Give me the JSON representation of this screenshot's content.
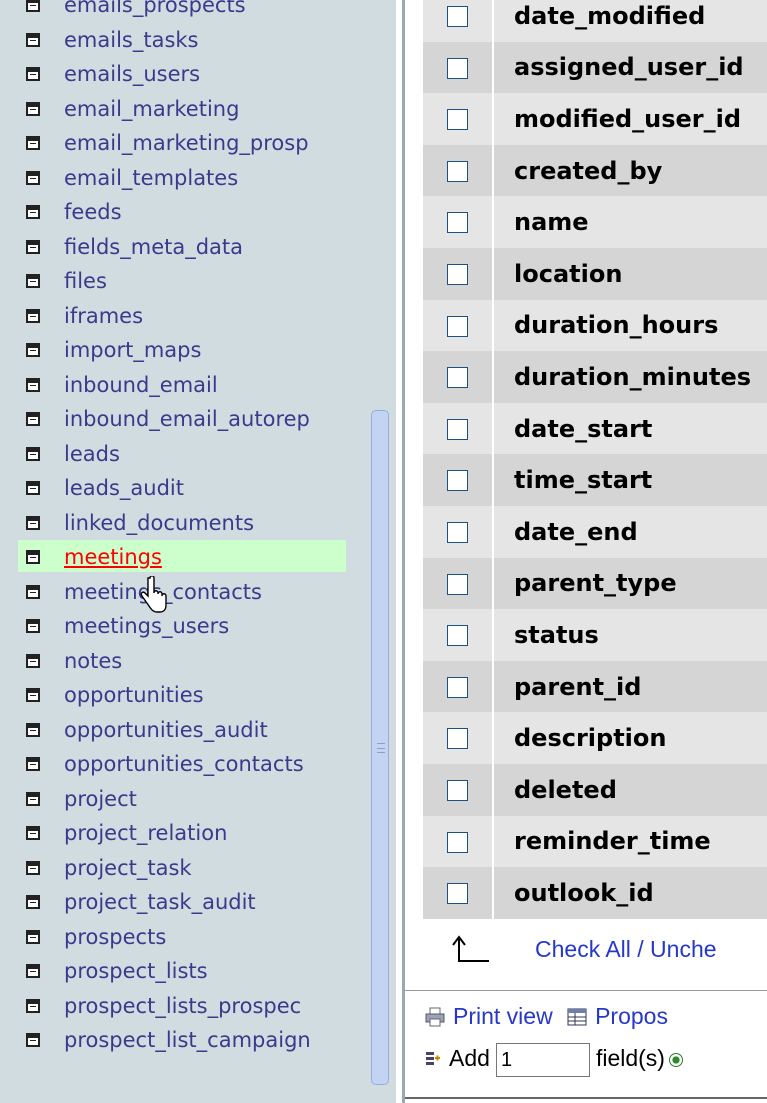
{
  "sidebar": {
    "items": [
      {
        "label": "emails_prospects"
      },
      {
        "label": "emails_tasks"
      },
      {
        "label": "emails_users"
      },
      {
        "label": "email_marketing"
      },
      {
        "label": "email_marketing_prosp"
      },
      {
        "label": "email_templates"
      },
      {
        "label": "feeds"
      },
      {
        "label": "fields_meta_data"
      },
      {
        "label": "files"
      },
      {
        "label": "iframes"
      },
      {
        "label": "import_maps"
      },
      {
        "label": "inbound_email"
      },
      {
        "label": "inbound_email_autorep"
      },
      {
        "label": "leads"
      },
      {
        "label": "leads_audit"
      },
      {
        "label": "linked_documents"
      },
      {
        "label": "meetings"
      },
      {
        "label": "meetings_contacts"
      },
      {
        "label": "meetings_users"
      },
      {
        "label": "notes"
      },
      {
        "label": "opportunities"
      },
      {
        "label": "opportunities_audit"
      },
      {
        "label": "opportunities_contacts"
      },
      {
        "label": "project"
      },
      {
        "label": "project_relation"
      },
      {
        "label": "project_task"
      },
      {
        "label": "project_task_audit"
      },
      {
        "label": "prospects"
      },
      {
        "label": "prospect_lists"
      },
      {
        "label": "prospect_lists_prospec"
      },
      {
        "label": "prospect_list_campaign"
      }
    ],
    "active_index": 16
  },
  "fields": {
    "rows": [
      {
        "name": "date_modified"
      },
      {
        "name": "assigned_user_id"
      },
      {
        "name": "modified_user_id"
      },
      {
        "name": "created_by"
      },
      {
        "name": "name"
      },
      {
        "name": "location"
      },
      {
        "name": "duration_hours"
      },
      {
        "name": "duration_minutes"
      },
      {
        "name": "date_start"
      },
      {
        "name": "time_start"
      },
      {
        "name": "date_end"
      },
      {
        "name": "parent_type"
      },
      {
        "name": "status"
      },
      {
        "name": "parent_id"
      },
      {
        "name": "description"
      },
      {
        "name": "deleted"
      },
      {
        "name": "reminder_time"
      },
      {
        "name": "outlook_id"
      }
    ]
  },
  "actions": {
    "check_all": "Check All",
    "separator": " / ",
    "uncheck_all": "Unche",
    "print_view": "Print view",
    "propose": "Propos",
    "add_label": "Add",
    "add_value": "1",
    "fields_label": "field(s)"
  },
  "icons": {
    "table": "table-icon",
    "print": "printer-icon",
    "propose": "table-structure-icon",
    "add": "add-field-icon",
    "arrow": "arrow-up-icon",
    "cursor": "hand-pointer-icon"
  },
  "colors": {
    "sidebar_bg": "#d0dce0",
    "link": "#3a3a8c",
    "active_link": "#ff0000",
    "active_bg": "#ccffcc",
    "row_light": "#e5e5e5",
    "row_dark": "#d5d5d5"
  }
}
